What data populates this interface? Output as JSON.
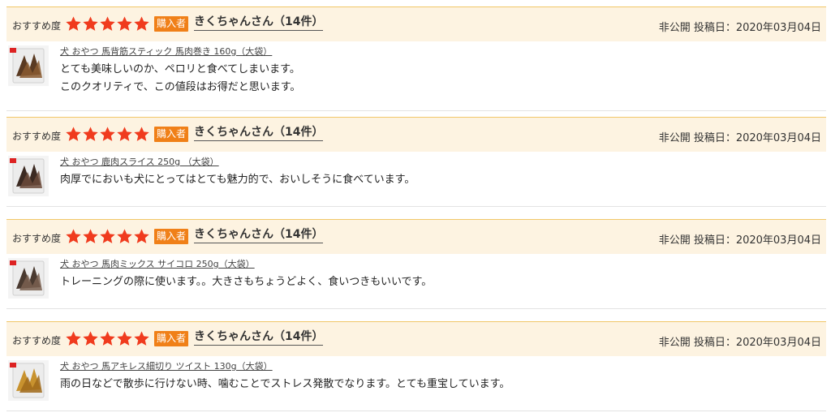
{
  "reviews": [
    {
      "recommend_label": "おすすめ度",
      "stars": 5,
      "buyer_badge": "購入者",
      "user": "きくちゃんさん（14件）",
      "meta": "非公開 投稿日：2020年03月04日",
      "product": "犬 おやつ 馬背筋スティック 馬肉巻き 160g（大袋）",
      "lines": [
        "とても美味しいのか、ペロリと食べてしまいます。",
        "このクオリティで、この値段はお得だと思います。"
      ],
      "thumb_colors": [
        "#5a3a22",
        "#8a5a30"
      ]
    },
    {
      "recommend_label": "おすすめ度",
      "stars": 5,
      "buyer_badge": "購入者",
      "user": "きくちゃんさん（14件）",
      "meta": "非公開 投稿日：2020年03月04日",
      "product": "犬 おやつ 鹿肉スライス 250g （大袋）",
      "lines": [
        "肉厚でにおいも犬にとってはとても魅力的で、おいしそうに食べています。"
      ],
      "thumb_colors": [
        "#3c2a22",
        "#6b4a3a"
      ]
    },
    {
      "recommend_label": "おすすめ度",
      "stars": 5,
      "buyer_badge": "購入者",
      "user": "きくちゃんさん（14件）",
      "meta": "非公開 投稿日：2020年03月04日",
      "product": "犬 おやつ 馬肉ミックス サイコロ 250g（大袋）",
      "lines": [
        "トレーニングの際に使います。。大きさもちょうどよく、食いつきもいいです。"
      ],
      "thumb_colors": [
        "#4a3a30",
        "#7a6050"
      ]
    },
    {
      "recommend_label": "おすすめ度",
      "stars": 5,
      "buyer_badge": "購入者",
      "user": "きくちゃんさん（14件）",
      "meta": "非公開 投稿日：2020年03月04日",
      "product": "犬 おやつ 馬アキレス細切り ツイスト 130g（大袋）",
      "lines": [
        "雨の日などで散歩に行けない時、噛むことでストレス発散でなります。とても重宝しています。"
      ],
      "thumb_colors": [
        "#c8922e",
        "#a06a1a"
      ]
    }
  ],
  "colors": {
    "header_bg": "#fdf3e1",
    "header_border": "#f1c768",
    "star": "#f03b1e",
    "buyer_badge": "#f08018"
  },
  "icons": {
    "star": "star-icon",
    "thumbnail": "product-thumbnail"
  }
}
